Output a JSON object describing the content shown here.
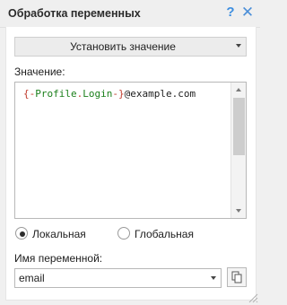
{
  "window": {
    "title": "Обработка переменных",
    "help_icon": "question-mark-icon",
    "close_icon": "close-x-icon"
  },
  "action_dropdown": {
    "selected": "Установить значение"
  },
  "value_field": {
    "label": "Значение:",
    "tokens": {
      "brace_open": "{-",
      "var_part1": "Profile",
      "dot": ".",
      "var_part2": "Login",
      "brace_close": "-}",
      "suffix": "@example.com"
    }
  },
  "scope": {
    "local_label": "Локальная",
    "global_label": "Глобальная",
    "selected": "local"
  },
  "variable_name": {
    "label": "Имя переменной:",
    "value": "email",
    "copy_icon": "copy-icon"
  },
  "colors": {
    "accent": "#3d8ee0",
    "code_brace": "#c0392b",
    "code_variable": "#1a7f1a"
  }
}
